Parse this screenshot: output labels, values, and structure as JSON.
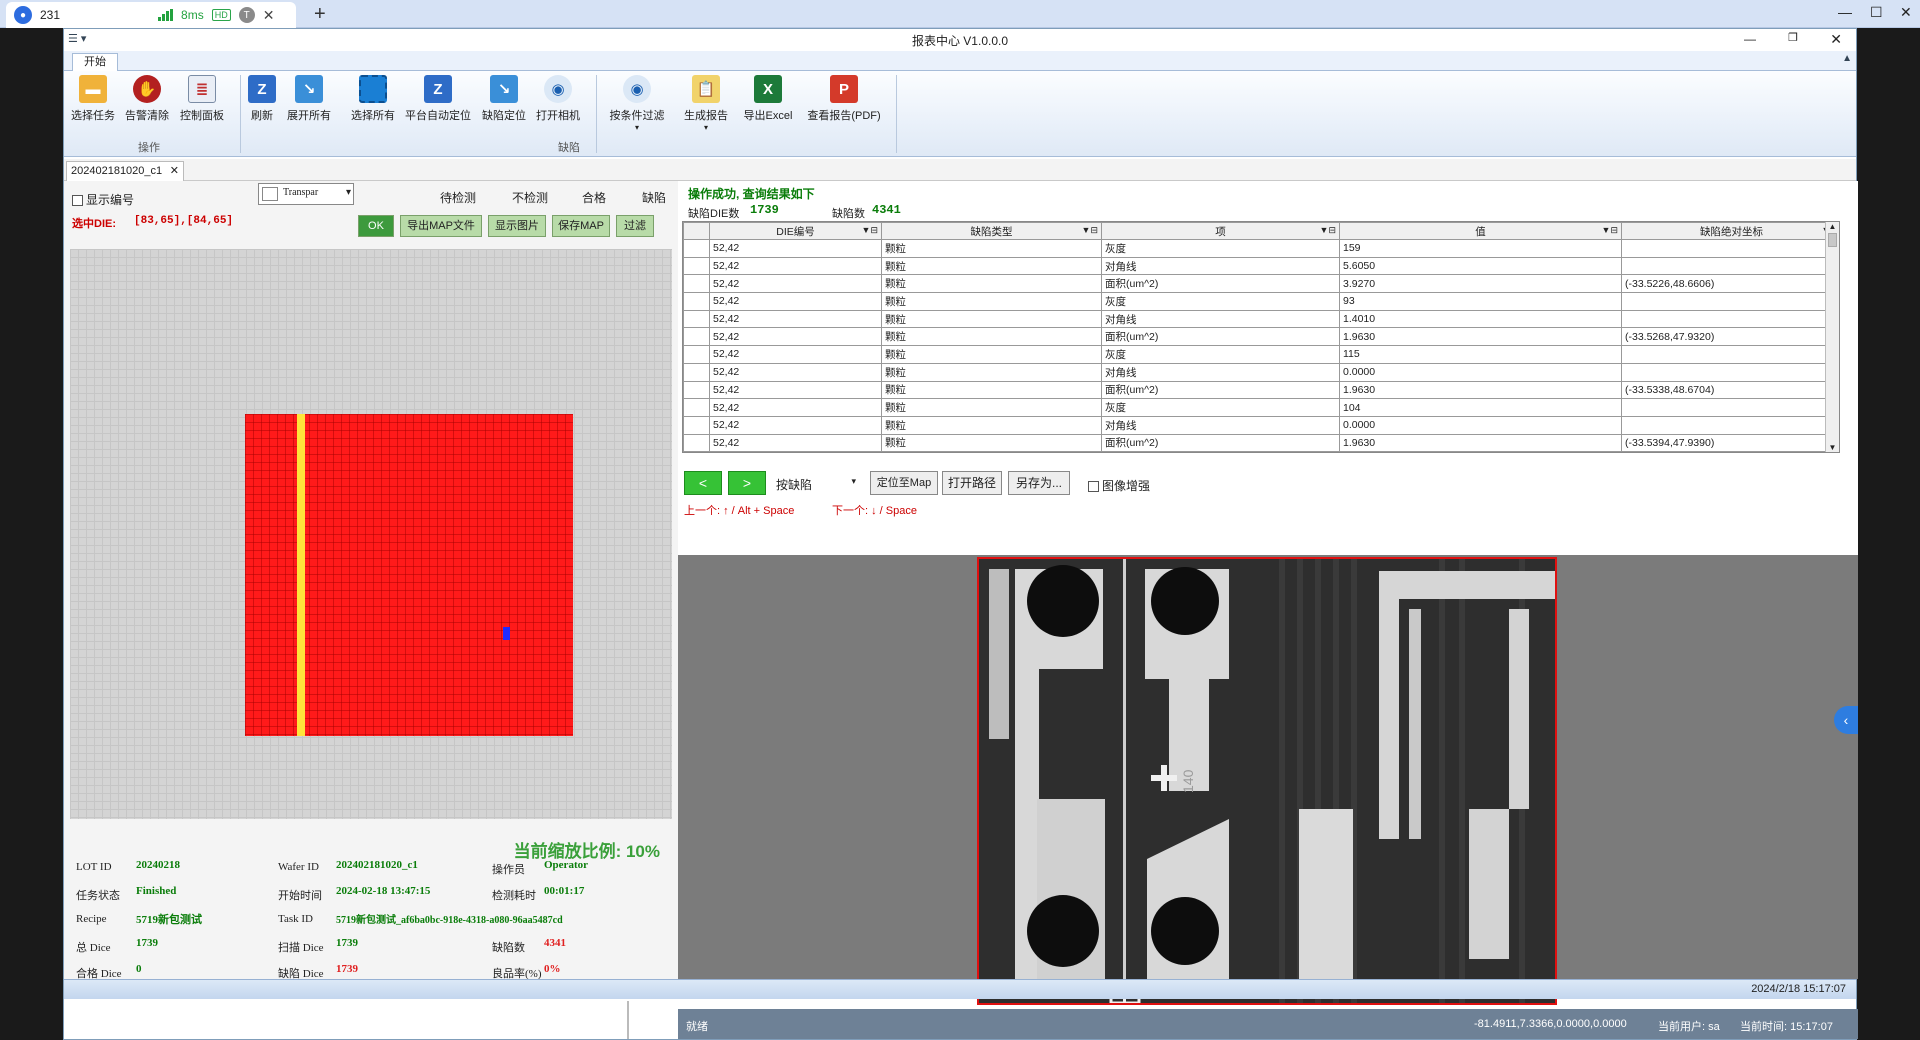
{
  "remote": {
    "tab_title": "231",
    "latency": "8ms",
    "hd_badge": "HD",
    "t_badge": "T",
    "close_glyph": "✕",
    "plus_glyph": "+"
  },
  "window": {
    "title": "报表中心 V1.0.0.0"
  },
  "ribbon": {
    "tab": "开始",
    "buttons": [
      {
        "label": "选择任务",
        "icon": "folder-icon"
      },
      {
        "label": "告警清除",
        "icon": "alarm-clear-icon"
      },
      {
        "label": "控制面板",
        "icon": "control-panel-icon"
      },
      {
        "label": "刷新",
        "icon": "refresh-icon"
      },
      {
        "label": "展开所有",
        "icon": "expand-icon"
      },
      {
        "label": "选择所有",
        "icon": "select-all-icon"
      },
      {
        "label": "平台自动定位",
        "icon": "auto-locate-icon"
      },
      {
        "label": "缺陷定位",
        "icon": "defect-locate-icon"
      },
      {
        "label": "打开相机",
        "icon": "camera-icon"
      },
      {
        "label": "按条件过滤",
        "icon": "filter-icon"
      },
      {
        "label": "生成报告",
        "icon": "report-icon"
      },
      {
        "label": "导出Excel",
        "icon": "excel-icon"
      },
      {
        "label": "查看报告(PDF)",
        "icon": "pdf-icon"
      }
    ],
    "group_ops": "操作",
    "group_defect": "缺陷"
  },
  "doc_tab": "202402181020_c1",
  "left": {
    "show_id_label": "显示编号",
    "transparency_select": "Transpar",
    "legend": [
      "待检测",
      "不检测",
      "合格",
      "缺陷"
    ],
    "selected_die_label": "选中DIE:",
    "selected_die_value": "[83,65],[84,65]",
    "btn_ok": "OK",
    "btn_export_map": "导出MAP文件",
    "btn_show_image": "显示图片",
    "btn_save_map": "保存MAP",
    "btn_filter": "过滤",
    "zoom_text": "当前缩放比例: 10%"
  },
  "info": {
    "lot_id_label": "LOT ID",
    "lot_id": "20240218",
    "wafer_id_label": "Wafer ID",
    "wafer_id": "202402181020_c1",
    "operator_label": "操作员",
    "operator": "Operator",
    "task_status_label": "任务状态",
    "task_status": "Finished",
    "start_time_label": "开始时间",
    "start_time": "2024-02-18 13:47:15",
    "elapsed_label": "检测耗时",
    "elapsed": "00:01:17",
    "recipe_label": "Recipe",
    "recipe": "5719新包测试",
    "task_id_label": "Task ID",
    "task_id": "5719新包测试_af6ba0bc-918e-4318-a080-96aa5487cd",
    "total_dice_label": "总 Dice",
    "total_dice": "1739",
    "scan_dice_label": "扫描 Dice",
    "scan_dice": "1739",
    "defect_count_label": "缺陷数",
    "defect_count": "4341",
    "pass_dice_label": "合格 Dice",
    "pass_dice": "0",
    "defect_dice_label": "缺陷 Dice",
    "defect_dice": "1739",
    "yield_label": "良品率(%)",
    "yield": "0%"
  },
  "right": {
    "result_msg": "操作成功, 查询结果如下",
    "defect_die_label": "缺陷DIE数",
    "defect_die_count": "1739",
    "defect_num_label": "缺陷数",
    "defect_num": "4341",
    "columns": [
      "DIE编号",
      "缺陷类型",
      "项",
      "值",
      "缺陷绝对坐标"
    ],
    "rows": [
      [
        "52,42",
        "颗粒",
        "灰度",
        "159",
        ""
      ],
      [
        "52,42",
        "颗粒",
        "对角线",
        "5.6050",
        ""
      ],
      [
        "52,42",
        "颗粒",
        "面积(um^2)",
        "3.9270",
        "(-33.5226,48.6606)"
      ],
      [
        "52,42",
        "颗粒",
        "灰度",
        "93",
        ""
      ],
      [
        "52,42",
        "颗粒",
        "对角线",
        "1.4010",
        ""
      ],
      [
        "52,42",
        "颗粒",
        "面积(um^2)",
        "1.9630",
        "(-33.5268,47.9320)"
      ],
      [
        "52,42",
        "颗粒",
        "灰度",
        "115",
        ""
      ],
      [
        "52,42",
        "颗粒",
        "对角线",
        "0.0000",
        ""
      ],
      [
        "52,42",
        "颗粒",
        "面积(um^2)",
        "1.9630",
        "(-33.5338,48.6704)"
      ],
      [
        "52,42",
        "颗粒",
        "灰度",
        "104",
        ""
      ],
      [
        "52,42",
        "颗粒",
        "对角线",
        "0.0000",
        ""
      ],
      [
        "52,42",
        "颗粒",
        "面积(um^2)",
        "1.9630",
        "(-33.5394,47.9390)"
      ]
    ],
    "nav_prev": "<",
    "nav_next": ">",
    "sort_select": "按缺陷",
    "btn_locate_map": "定位至Map",
    "btn_open_path": "打开路径",
    "btn_save_as": "另存为...",
    "image_enhance": "图像增强",
    "prev_hint": "上一个: ↑ / Alt + Space",
    "next_hint": "下一个: ↓ / Space",
    "image_marker": "140"
  },
  "status": {
    "datetime": "2024/2/18 15:17:07",
    "ready": "就绪",
    "coords": "-81.4911,7.3366,0.0000,0.0000",
    "user": "当前用户: sa",
    "time": "当前时间: 15:17:07"
  },
  "colors": {
    "defect_red": "#ff1a1a",
    "pending_yellow": "#ffe43a",
    "selected_blue": "#1d2cff",
    "ok_green": "#0a7d0a"
  }
}
